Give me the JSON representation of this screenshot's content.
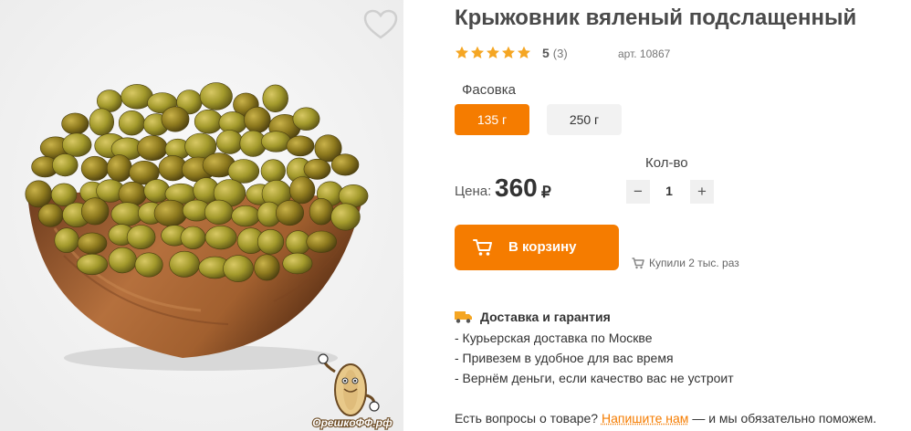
{
  "product": {
    "title": "Крыжовник вяленый подслащенный",
    "rating": {
      "stars": 5,
      "max": 5,
      "value": "5",
      "count": "(3)",
      "star_color": "#f5a623"
    },
    "sku": "арт. 10867",
    "watermark_text": "ОрешкоФФ.рф"
  },
  "packaging": {
    "label": "Фасовка",
    "options": [
      {
        "label": "135 г",
        "selected": true
      },
      {
        "label": "250 г",
        "selected": false
      }
    ]
  },
  "quantity": {
    "label": "Кол-во",
    "value": "1",
    "minus": "−",
    "plus": "+"
  },
  "price": {
    "label": "Цена:",
    "value": "360",
    "currency": "₽"
  },
  "cart": {
    "button_label": "В корзину",
    "icon": "cart-icon"
  },
  "purchases": {
    "text": "Купили 2 тыс. раз",
    "icon": "cart-small-icon"
  },
  "delivery": {
    "heading": "Доставка и гарантия",
    "icon": "truck-icon",
    "items": [
      "- Курьерская доставка по Москве",
      "- Привезем в удобное для вас время",
      "- Вернём деньги, если качество вас не устроит"
    ]
  },
  "contact": {
    "prefix": "Есть вопросы о товаре?",
    "link": "Напишите нам",
    "suffix": "— и мы обязательно поможем."
  },
  "colors": {
    "accent": "#f57c00",
    "text": "#333333",
    "muted": "#777777"
  }
}
